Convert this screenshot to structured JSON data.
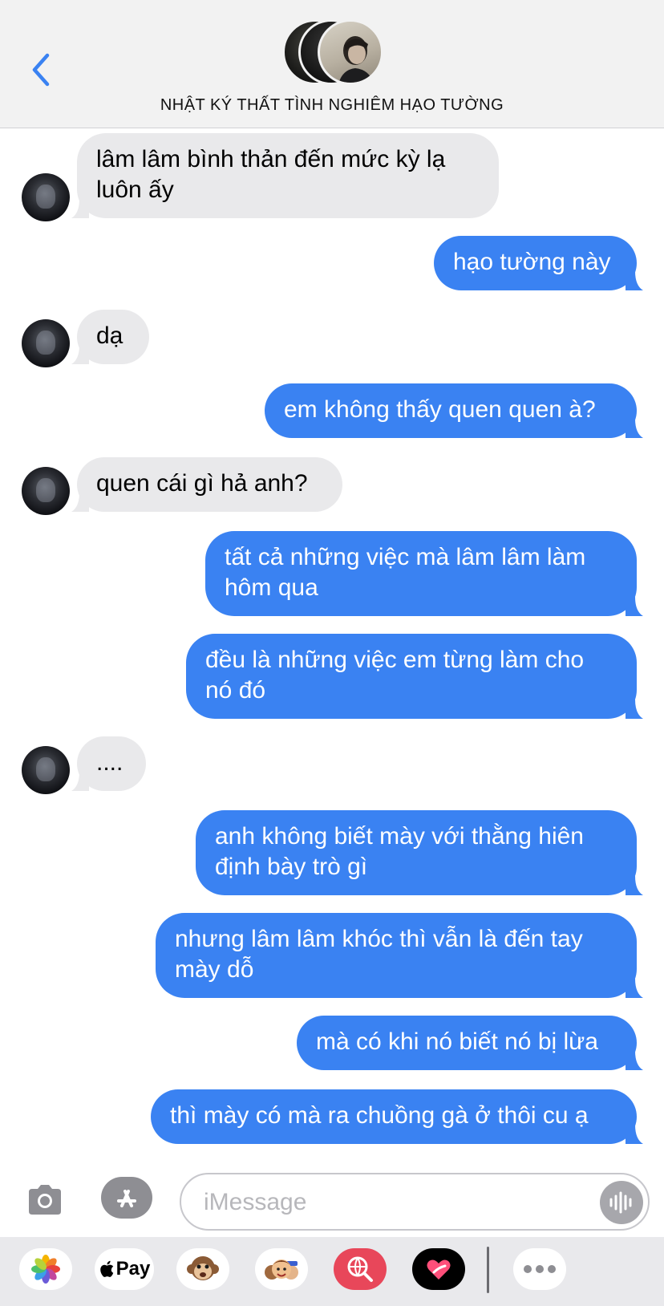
{
  "header": {
    "back_icon": "chevron-left-icon",
    "title": "NHẬT KÝ THẤT TÌNH NGHIÊM HẠO TƯỜNG"
  },
  "colors": {
    "accent": "#3a82f2",
    "incoming_bubble": "#e9e9eb",
    "header_bg": "#f2f2f2"
  },
  "messages": [
    {
      "direction": "incoming",
      "text": "lâm lâm bình thản đến mức kỳ lạ\nluôn ấy"
    },
    {
      "direction": "outgoing",
      "text": "hạo tường này"
    },
    {
      "direction": "incoming",
      "text": "dạ"
    },
    {
      "direction": "outgoing",
      "text": "em không thấy quen quen à?"
    },
    {
      "direction": "incoming",
      "text": "quen cái gì hả anh?"
    },
    {
      "direction": "outgoing",
      "text": "tất cả những việc mà lâm lâm làm\nhôm qua"
    },
    {
      "direction": "outgoing",
      "text": "đều là những việc em từng làm cho\nnó đó"
    },
    {
      "direction": "incoming",
      "text": "...."
    },
    {
      "direction": "outgoing",
      "text": "anh không biết mày với thằng hiên\nđịnh bày trò gì"
    },
    {
      "direction": "outgoing",
      "text": "nhưng lâm lâm khóc thì vẫn là đến tay\nmày dỗ"
    },
    {
      "direction": "outgoing",
      "text": "mà có khi nó biết nó bị lừa"
    },
    {
      "direction": "outgoing",
      "text": "thì mày có mà ra chuồng gà ở thôi cu ạ"
    }
  ],
  "input": {
    "placeholder": "iMessage",
    "camera_icon": "camera-icon",
    "appstore_icon": "app-store-icon",
    "audio_icon": "audio-waveform-icon"
  },
  "drawer": {
    "apps": [
      {
        "name": "photos",
        "icon": "photos-icon"
      },
      {
        "name": "apple-pay",
        "icon": "apple-pay-icon",
        "label": "Pay"
      },
      {
        "name": "animoji",
        "icon": "monkey-icon"
      },
      {
        "name": "memoji",
        "icon": "memoji-icon"
      },
      {
        "name": "images-search",
        "icon": "globe-search-icon"
      },
      {
        "name": "digital-touch",
        "icon": "heart-touch-icon"
      },
      {
        "name": "more",
        "icon": "more-icon"
      }
    ]
  }
}
